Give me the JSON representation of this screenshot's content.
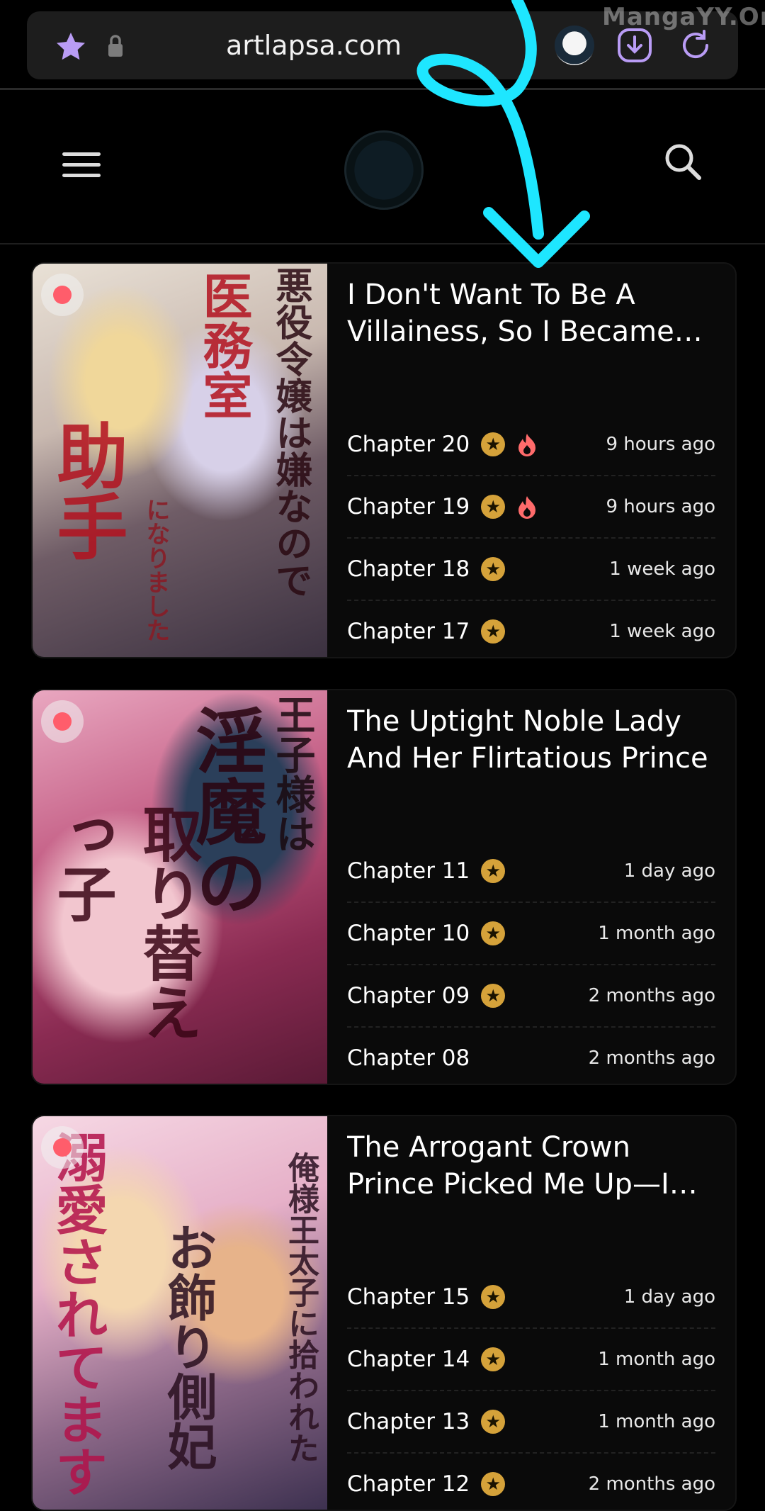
{
  "browser": {
    "url": "artlapsa.com",
    "watermark": "MangaYY.Org"
  },
  "colors": {
    "background": "#000000",
    "card": "#0a0a0a",
    "star_badge": "#d5a23a",
    "hot_badge": "#ff6b6b",
    "bookmark_dot": "#ff5d6b",
    "annotation_arrow": "#1ee6ff"
  },
  "header": {
    "menu_icon": "hamburger-menu-icon",
    "logo_icon": "site-logo-icon",
    "search_icon": "search-icon"
  },
  "mangas": [
    {
      "title": "I Don't Want To Be A Villainess, So I Became the Assistant of the Medical Office",
      "cover_text": [
        "悪役令嬢は嫌なので",
        "医務室",
        "助手",
        "になりました"
      ],
      "chapters": [
        {
          "label": "Chapter 20",
          "time": "9 hours ago",
          "star": true,
          "hot": true
        },
        {
          "label": "Chapter 19",
          "time": "9 hours ago",
          "star": true,
          "hot": true
        },
        {
          "label": "Chapter 18",
          "time": "1 week ago",
          "star": true,
          "hot": false
        },
        {
          "label": "Chapter 17",
          "time": "1 week ago",
          "star": true,
          "hot": false
        }
      ]
    },
    {
      "title": "The Uptight Noble Lady And Her Flirtatious Prince",
      "cover_text": [
        "王子様は",
        "淫魔の",
        "取り替えっ子"
      ],
      "chapters": [
        {
          "label": "Chapter 11",
          "time": "1 day ago",
          "star": true,
          "hot": false
        },
        {
          "label": "Chapter 10",
          "time": "1 month ago",
          "star": true,
          "hot": false
        },
        {
          "label": "Chapter 09",
          "time": "2 months ago",
          "star": true,
          "hot": false
        },
        {
          "label": "Chapter 08",
          "time": "2 months ago",
          "star": false,
          "hot": false
        }
      ]
    },
    {
      "title": "The Arrogant Crown Prince Picked Me Up—I Was Supposed to Be a Decorative Consort",
      "cover_text": [
        "俺様王太子に拾われた",
        "お飾り側妃",
        "溺愛されてます"
      ],
      "chapters": [
        {
          "label": "Chapter 15",
          "time": "1 day ago",
          "star": true,
          "hot": false
        },
        {
          "label": "Chapter 14",
          "time": "1 month ago",
          "star": true,
          "hot": false
        },
        {
          "label": "Chapter 13",
          "time": "1 month ago",
          "star": true,
          "hot": false
        },
        {
          "label": "Chapter 12",
          "time": "2 months ago",
          "star": true,
          "hot": false
        }
      ]
    }
  ]
}
